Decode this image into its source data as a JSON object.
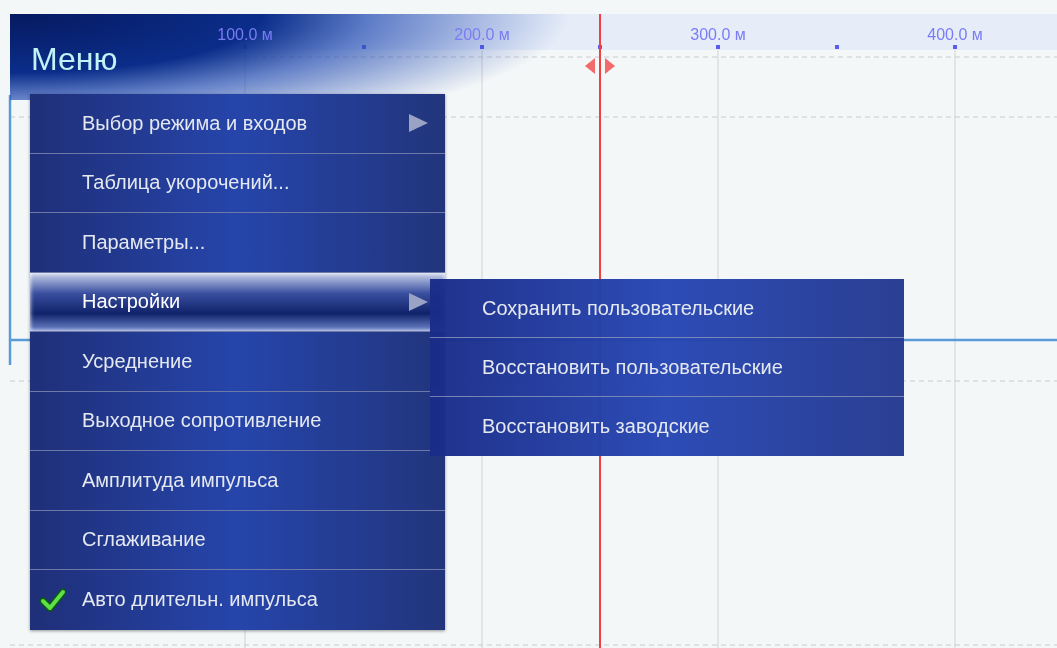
{
  "ruler": {
    "labels": [
      "100.0 м",
      "200.0 м",
      "300.0 м",
      "400.0 м"
    ]
  },
  "menu": {
    "title": "Меню",
    "items": [
      {
        "label": "Выбор режима и входов",
        "has_submenu": true,
        "selected": false,
        "checked": false
      },
      {
        "label": "Таблица укорочений...",
        "has_submenu": false,
        "selected": false,
        "checked": false
      },
      {
        "label": "Параметры...",
        "has_submenu": false,
        "selected": false,
        "checked": false
      },
      {
        "label": "Настройки",
        "has_submenu": true,
        "selected": true,
        "checked": false
      },
      {
        "label": "Усреднение",
        "has_submenu": false,
        "selected": false,
        "checked": false
      },
      {
        "label": "Выходное сопротивление",
        "has_submenu": false,
        "selected": false,
        "checked": false
      },
      {
        "label": "Амплитуда импульса",
        "has_submenu": false,
        "selected": false,
        "checked": false
      },
      {
        "label": "Сглаживание",
        "has_submenu": false,
        "selected": false,
        "checked": false
      },
      {
        "label": "Авто длительн. импульса",
        "has_submenu": false,
        "selected": false,
        "checked": true
      }
    ]
  },
  "submenu": {
    "items": [
      {
        "label": "Сохранить пользовательские"
      },
      {
        "label": "Восстановить пользовательские"
      },
      {
        "label": "Восстановить заводские"
      }
    ]
  }
}
